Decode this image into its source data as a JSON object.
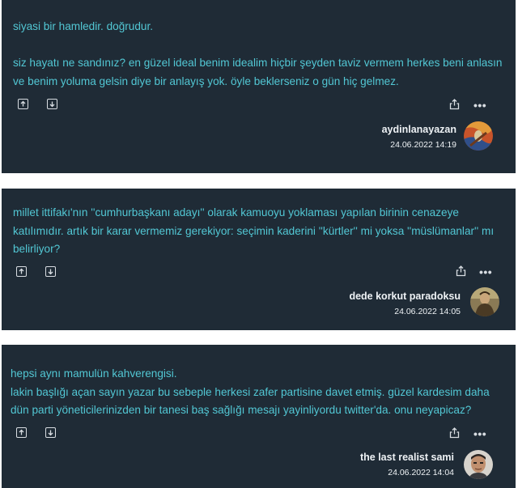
{
  "entries": [
    {
      "text": "siyasi bir hamledir. doğrudur.\n\nsiz hayatı ne sandınız? en güzel ideal benim idealim hiçbir şeyden taviz vermem herkes beni anlasın ve benim yoluma gelsin diye bir anlayış yok. öyle beklerseniz o gün hiç gelmez.",
      "author": "aydinlanayazan",
      "date": "24.06.2022 14:19",
      "more_label": "•••",
      "avatar_icon": "painting-avatar"
    },
    {
      "text": "millet ittifakı'nın ''cumhurbaşkanı adayı'' olarak kamuoyu yoklaması yapılan birinin cenazeye katılımıdır. artık bir karar vermemiz gerekiyor: seçimin kaderini ''kürtler'' mi yoksa ''müslümanlar'' mı belirliyor?",
      "author": "dede korkut paradoksu",
      "date": "24.06.2022 14:05",
      "more_label": "•••",
      "avatar_icon": "portrait-avatar"
    },
    {
      "text": "hepsi aynı mamulün kahverengisi.\nlakin başlığı açan sayın yazar bu sebeple herkesi zafer partisine davet etmiş. güzel kardesim daha dün parti yöneticilerinizden bir tanesi baş sağlığı mesajı yayinliyordu twitter'da. onu neyapicaz?",
      "author": "the last realist sami",
      "date": "24.06.2022 14:04",
      "more_label": "•••",
      "avatar_icon": "face-avatar"
    }
  ],
  "colors": {
    "card_bg": "#1f2b36",
    "text": "#52c7d4",
    "meta": "#eef2f5",
    "icon": "#d8dde2"
  }
}
